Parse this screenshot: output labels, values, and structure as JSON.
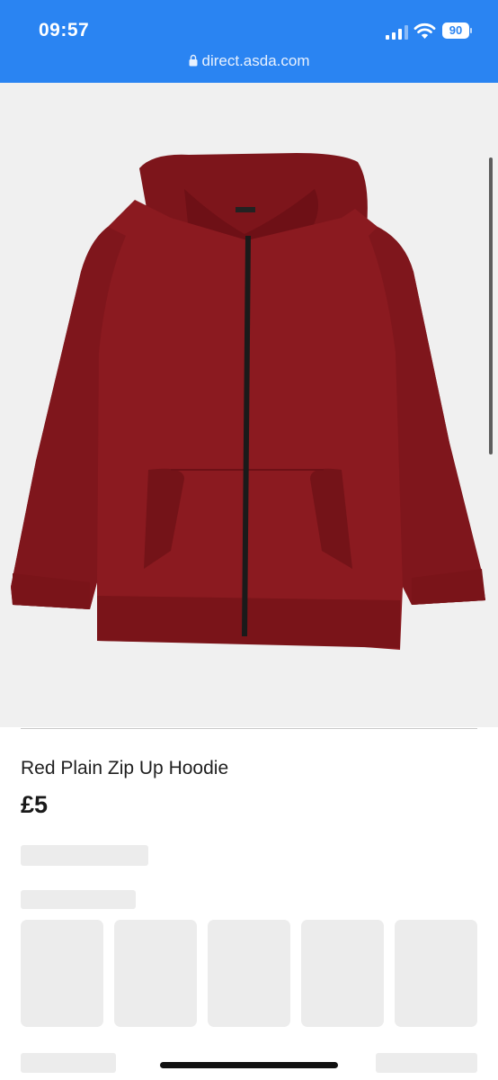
{
  "status_bar": {
    "time": "09:57",
    "battery": "90",
    "icons": [
      "cellular-signal-icon",
      "wifi-icon",
      "battery-icon"
    ]
  },
  "browser": {
    "url": "direct.asda.com",
    "icon": "lock-icon"
  },
  "product": {
    "image_alt_subject": "red zip up hoodie",
    "title": "Red Plain Zip Up Hoodie",
    "price": "£5"
  },
  "colors": {
    "status_bar_bg": "#2a84f2",
    "hoodie": "#8b1a20",
    "skeleton": "#ececec"
  }
}
